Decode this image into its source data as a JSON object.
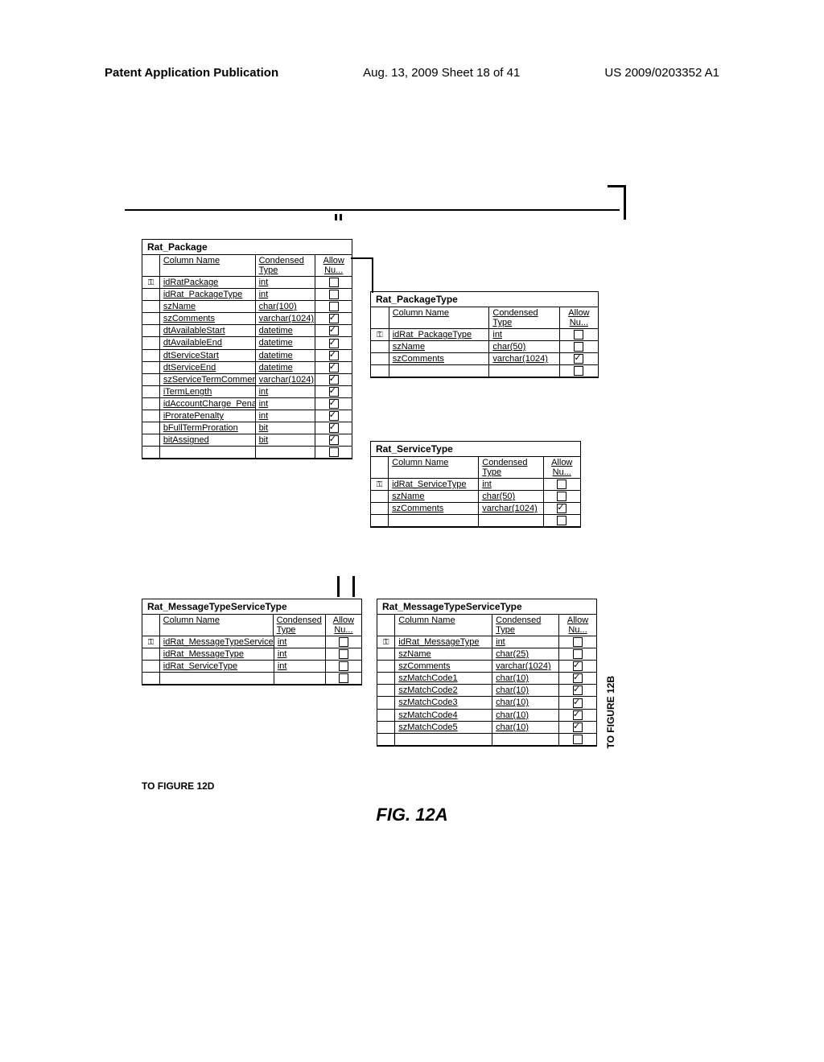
{
  "header": {
    "left": "Patent Application Publication",
    "center": "Aug. 13, 2009  Sheet 18 of 41",
    "right": "US 2009/0203352 A1"
  },
  "figure_caption": "FIG. 12A",
  "ref_bottom": "TO FIGURE 12D",
  "ref_right": "TO FIGURE 12B",
  "col_headers": {
    "name": "Column Name",
    "type": "Condensed Type",
    "null": "Allow Nu..."
  },
  "tables": {
    "rat_package": {
      "title": "Rat_Package",
      "rows": [
        {
          "key": true,
          "name": "idRatPackage",
          "type": "int",
          "allow": false
        },
        {
          "key": false,
          "name": "idRat_PackageType",
          "type": "int",
          "allow": false
        },
        {
          "key": false,
          "name": "szName",
          "type": "char(100)",
          "allow": false
        },
        {
          "key": false,
          "name": "szComments",
          "type": "varchar(1024)",
          "allow": true
        },
        {
          "key": false,
          "name": "dtAvailableStart",
          "type": "datetime",
          "allow": true
        },
        {
          "key": false,
          "name": "dtAvailableEnd",
          "type": "datetime",
          "allow": true
        },
        {
          "key": false,
          "name": "dtServiceStart",
          "type": "datetime",
          "allow": true
        },
        {
          "key": false,
          "name": "dtServiceEnd",
          "type": "datetime",
          "allow": true
        },
        {
          "key": false,
          "name": "szServiceTermComments",
          "type": "varchar(1024)",
          "allow": true
        },
        {
          "key": false,
          "name": "iTermLength",
          "type": "int",
          "allow": true
        },
        {
          "key": false,
          "name": "idAccountCharge_Penalty",
          "type": "int",
          "allow": true
        },
        {
          "key": false,
          "name": "iProratePenalty",
          "type": "int",
          "allow": true
        },
        {
          "key": false,
          "name": "bFullTermProration",
          "type": "bit",
          "allow": true
        },
        {
          "key": false,
          "name": "bitAssigned",
          "type": "bit",
          "allow": true
        },
        {
          "key": false,
          "name": "",
          "type": "",
          "allow": false
        }
      ]
    },
    "rat_packagetype": {
      "title": "Rat_PackageType",
      "rows": [
        {
          "key": true,
          "name": "idRat_PackageType",
          "type": "int",
          "allow": false
        },
        {
          "key": false,
          "name": "szName",
          "type": "char(50)",
          "allow": false
        },
        {
          "key": false,
          "name": "szComments",
          "type": "varchar(1024)",
          "allow": true
        },
        {
          "key": false,
          "name": "",
          "type": "",
          "allow": false
        }
      ]
    },
    "rat_servicetype": {
      "title": "Rat_ServiceType",
      "rows": [
        {
          "key": true,
          "name": "idRat_ServiceType",
          "type": "int",
          "allow": false
        },
        {
          "key": false,
          "name": "szName",
          "type": "char(50)",
          "allow": false
        },
        {
          "key": false,
          "name": "szComments",
          "type": "varchar(1024)",
          "allow": true
        },
        {
          "key": false,
          "name": "",
          "type": "",
          "allow": false
        }
      ]
    },
    "rat_msgst_left": {
      "title": "Rat_MessageTypeServiceType",
      "rows": [
        {
          "key": true,
          "name": "idRat_MessageTypeServiceType",
          "type": "int",
          "allow": false
        },
        {
          "key": false,
          "name": "idRat_MessageType",
          "type": "int",
          "allow": false
        },
        {
          "key": false,
          "name": "idRat_ServiceType",
          "type": "int",
          "allow": false
        },
        {
          "key": false,
          "name": "",
          "type": "",
          "allow": false
        }
      ]
    },
    "rat_msgst_right": {
      "title": "Rat_MessageTypeServiceType",
      "rows": [
        {
          "key": true,
          "name": "idRat_MessageType",
          "type": "int",
          "allow": false
        },
        {
          "key": false,
          "name": "szName",
          "type": "char(25)",
          "allow": false
        },
        {
          "key": false,
          "name": "szComments",
          "type": "varchar(1024)",
          "allow": true
        },
        {
          "key": false,
          "name": "szMatchCode1",
          "type": "char(10)",
          "allow": true
        },
        {
          "key": false,
          "name": "szMatchCode2",
          "type": "char(10)",
          "allow": true
        },
        {
          "key": false,
          "name": "szMatchCode3",
          "type": "char(10)",
          "allow": true
        },
        {
          "key": false,
          "name": "szMatchCode4",
          "type": "char(10)",
          "allow": true
        },
        {
          "key": false,
          "name": "szMatchCode5",
          "type": "char(10)",
          "allow": true
        },
        {
          "key": false,
          "name": "",
          "type": "",
          "allow": false
        }
      ]
    }
  }
}
